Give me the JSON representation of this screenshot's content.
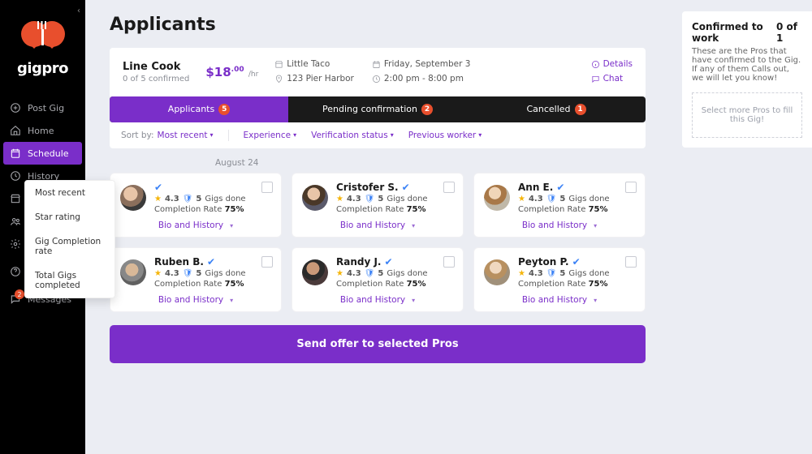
{
  "sidebar": {
    "brand": "gigpro",
    "items": [
      {
        "label": "Post Gig",
        "icon": "plus-circle"
      },
      {
        "label": "Home",
        "icon": "home"
      },
      {
        "label": "Schedule",
        "icon": "calendar",
        "active": true
      },
      {
        "label": "History",
        "icon": "clock"
      },
      {
        "label": "Locations",
        "icon": "storefront"
      },
      {
        "label": "Pros",
        "icon": "users"
      },
      {
        "label": "Settings",
        "icon": "gear"
      },
      {
        "label": "Need help?",
        "icon": "question"
      },
      {
        "label": "Messages",
        "icon": "chat",
        "badge": "2"
      }
    ]
  },
  "page": {
    "title": "Applicants"
  },
  "gig": {
    "role": "Line Cook",
    "confirmed_sub": "0 of 5 confirmed",
    "rate_amount": "$18",
    "rate_cents": ".00",
    "rate_per": "/hr",
    "venue": "Little Taco",
    "address": "123 Pier Harbor",
    "date": "Friday, September 3",
    "time": "2:00 pm - 8:00 pm",
    "details_label": "Details",
    "chat_label": "Chat"
  },
  "tabs": [
    {
      "label": "Applicants",
      "count": "5",
      "active": true
    },
    {
      "label": "Pending confirmation",
      "count": "2"
    },
    {
      "label": "Cancelled",
      "count": "1"
    }
  ],
  "filters": {
    "sort_label": "Sort by:",
    "sort_value": "Most recent",
    "experience": "Experience",
    "verification": "Verification status",
    "previous": "Previous worker"
  },
  "sort_options": [
    "Most recent",
    "Star rating",
    "Gig Completion rate",
    "Total Gigs completed"
  ],
  "date_group": "August 24",
  "applicants": [
    {
      "name": "",
      "rating": "4.3",
      "gigs": "5",
      "rate": "75%",
      "bio": "Bio and History",
      "av": "av1"
    },
    {
      "name": "Cristofer S.",
      "rating": "4.3",
      "gigs": "5",
      "rate": "75%",
      "bio": "Bio and History",
      "av": "av2"
    },
    {
      "name": "Ann E.",
      "rating": "4.3",
      "gigs": "5",
      "rate": "75%",
      "bio": "Bio and History",
      "av": "av3"
    },
    {
      "name": "Ruben B.",
      "rating": "4.3",
      "gigs": "5",
      "rate": "75%",
      "bio": "Bio and History",
      "av": "av4"
    },
    {
      "name": "Randy J.",
      "rating": "4.3",
      "gigs": "5",
      "rate": "75%",
      "bio": "Bio and History",
      "av": "av5"
    },
    {
      "name": "Peyton P.",
      "rating": "4.3",
      "gigs": "5",
      "rate": "75%",
      "bio": "Bio and History",
      "av": "av6"
    }
  ],
  "strings": {
    "gigs_suffix": "Gigs done",
    "rate_prefix": "Completion Rate",
    "send_offer": "Send offer to selected Pros"
  },
  "right": {
    "title": "Confirmed to work",
    "count": "0 of 1",
    "desc": "These are the Pros that have confirmed to the Gig. If any of them Calls out, we will let you know!",
    "cta": "Select more Pros to fill this Gig!"
  }
}
